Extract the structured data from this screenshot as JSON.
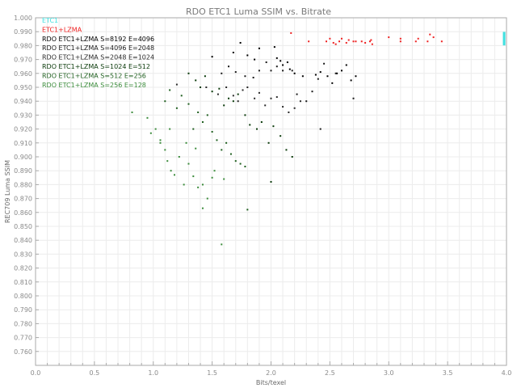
{
  "chart_data": {
    "type": "scatter",
    "title": "RDO ETC1 Luma SSIM vs. Bitrate",
    "xlabel": "Bits/texel",
    "ylabel": "REC709 Luma SSIM",
    "xlim": [
      0.0,
      4.0
    ],
    "ylim": [
      0.75,
      1.0
    ],
    "x_ticks": [
      "0.0",
      "0.5",
      "1.0",
      "1.5",
      "2.0",
      "2.5",
      "3.0",
      "3.5",
      "4.0"
    ],
    "y_ticks": [
      "0.760",
      "0.770",
      "0.780",
      "0.790",
      "0.800",
      "0.810",
      "0.820",
      "0.830",
      "0.840",
      "0.850",
      "0.860",
      "0.870",
      "0.880",
      "0.890",
      "0.900",
      "0.910",
      "0.920",
      "0.930",
      "0.940",
      "0.950",
      "0.960",
      "0.970",
      "0.980",
      "0.990",
      "1.000"
    ],
    "x_tick_values": [
      0.0,
      0.5,
      1.0,
      1.5,
      2.0,
      2.5,
      3.0,
      3.5,
      4.0
    ],
    "y_tick_values": [
      0.76,
      0.77,
      0.78,
      0.79,
      0.8,
      0.81,
      0.82,
      0.83,
      0.84,
      0.85,
      0.86,
      0.87,
      0.88,
      0.89,
      0.9,
      0.91,
      0.92,
      0.93,
      0.94,
      0.95,
      0.96,
      0.97,
      0.98,
      0.99,
      1.0
    ],
    "grid": true,
    "legend_position": "top-left",
    "series": [
      {
        "name": "ETC1",
        "color": "#40e0e0",
        "points": [
          [
            3.98,
            0.981
          ],
          [
            3.98,
            0.982
          ],
          [
            3.98,
            0.983
          ],
          [
            3.98,
            0.984
          ],
          [
            3.98,
            0.985
          ],
          [
            3.98,
            0.986
          ],
          [
            3.98,
            0.987
          ],
          [
            3.98,
            0.988
          ],
          [
            3.98,
            0.989
          ]
        ]
      },
      {
        "name": "ETC1+LZMA",
        "color": "#ee2222",
        "points": [
          [
            2.17,
            0.989
          ],
          [
            2.32,
            0.983
          ],
          [
            2.47,
            0.983
          ],
          [
            2.5,
            0.985
          ],
          [
            2.53,
            0.982
          ],
          [
            2.55,
            0.981
          ],
          [
            2.58,
            0.983
          ],
          [
            2.6,
            0.985
          ],
          [
            2.64,
            0.982
          ],
          [
            2.66,
            0.984
          ],
          [
            2.7,
            0.983
          ],
          [
            2.72,
            0.983
          ],
          [
            2.77,
            0.983
          ],
          [
            2.8,
            0.982
          ],
          [
            2.84,
            0.983
          ],
          [
            2.85,
            0.984
          ],
          [
            2.86,
            0.981
          ],
          [
            3.0,
            0.986
          ],
          [
            3.1,
            0.983
          ],
          [
            3.1,
            0.985
          ],
          [
            3.23,
            0.983
          ],
          [
            3.25,
            0.985
          ],
          [
            3.33,
            0.983
          ],
          [
            3.35,
            0.988
          ],
          [
            3.38,
            0.986
          ],
          [
            3.45,
            0.983
          ]
        ]
      },
      {
        "name": "RDO ETC1+LZMA S=8192 E=4096",
        "color": "#000000",
        "points": [
          [
            1.5,
            0.972
          ],
          [
            1.68,
            0.975
          ],
          [
            1.74,
            0.982
          ],
          [
            1.8,
            0.973
          ],
          [
            1.86,
            0.97
          ],
          [
            1.9,
            0.978
          ],
          [
            2.03,
            0.979
          ],
          [
            2.05,
            0.971
          ],
          [
            2.08,
            0.969
          ],
          [
            2.1,
            0.966
          ],
          [
            2.14,
            0.968
          ],
          [
            2.16,
            0.963
          ],
          [
            2.2,
            0.96
          ],
          [
            2.27,
            0.958
          ],
          [
            2.38,
            0.959
          ],
          [
            2.42,
            0.961
          ],
          [
            2.48,
            0.958
          ],
          [
            2.52,
            0.953
          ],
          [
            2.56,
            0.96
          ],
          [
            2.6,
            0.962
          ],
          [
            2.64,
            0.966
          ],
          [
            2.68,
            0.955
          ],
          [
            2.72,
            0.958
          ]
        ]
      },
      {
        "name": "RDO ETC1+LZMA S=4096 E=2048",
        "color": "#1a1a1a",
        "points": [
          [
            1.58,
            0.96
          ],
          [
            1.64,
            0.965
          ],
          [
            1.7,
            0.961
          ],
          [
            1.78,
            0.958
          ],
          [
            1.85,
            0.957
          ],
          [
            1.9,
            0.962
          ],
          [
            1.96,
            0.968
          ],
          [
            2.0,
            0.962
          ],
          [
            2.05,
            0.965
          ],
          [
            2.1,
            0.962
          ],
          [
            2.18,
            0.962
          ],
          [
            2.22,
            0.945
          ],
          [
            2.3,
            0.94
          ],
          [
            2.35,
            0.947
          ],
          [
            2.4,
            0.956
          ],
          [
            2.45,
            0.967
          ],
          [
            2.55,
            0.96
          ],
          [
            2.7,
            0.942
          ],
          [
            2.42,
            0.92
          ]
        ]
      },
      {
        "name": "RDO ETC1+LZMA S=2048 E=1024",
        "color": "#2a2a2a",
        "points": [
          [
            1.2,
            0.952
          ],
          [
            1.45,
            0.95
          ],
          [
            1.55,
            0.945
          ],
          [
            1.62,
            0.95
          ],
          [
            1.68,
            0.944
          ],
          [
            1.72,
            0.94
          ],
          [
            1.76,
            0.948
          ],
          [
            1.8,
            0.95
          ],
          [
            1.86,
            0.942
          ],
          [
            1.9,
            0.946
          ],
          [
            1.95,
            0.937
          ],
          [
            2.0,
            0.942
          ],
          [
            2.05,
            0.943
          ],
          [
            2.1,
            0.936
          ],
          [
            2.15,
            0.932
          ],
          [
            2.2,
            0.935
          ],
          [
            2.25,
            0.94
          ]
        ]
      },
      {
        "name": "RDO ETC1+LZMA S=1024 E=512",
        "color": "#0a3a0a",
        "points": [
          [
            1.3,
            0.96
          ],
          [
            1.36,
            0.955
          ],
          [
            1.4,
            0.95
          ],
          [
            1.44,
            0.958
          ],
          [
            1.5,
            0.947
          ],
          [
            1.56,
            0.949
          ],
          [
            1.6,
            0.937
          ],
          [
            1.64,
            0.942
          ],
          [
            1.68,
            0.94
          ],
          [
            1.72,
            0.945
          ],
          [
            1.78,
            0.93
          ],
          [
            1.82,
            0.923
          ],
          [
            1.88,
            0.92
          ],
          [
            1.92,
            0.925
          ],
          [
            1.98,
            0.91
          ],
          [
            2.02,
            0.922
          ],
          [
            2.08,
            0.915
          ],
          [
            2.13,
            0.905
          ],
          [
            2.18,
            0.9
          ],
          [
            2.0,
            0.882
          ]
        ]
      },
      {
        "name": "RDO ETC1+LZMA S=512 E=256",
        "color": "#1f5f1f",
        "points": [
          [
            1.1,
            0.94
          ],
          [
            1.14,
            0.948
          ],
          [
            1.2,
            0.935
          ],
          [
            1.24,
            0.944
          ],
          [
            1.3,
            0.938
          ],
          [
            1.34,
            0.92
          ],
          [
            1.38,
            0.932
          ],
          [
            1.42,
            0.925
          ],
          [
            1.46,
            0.93
          ],
          [
            1.5,
            0.918
          ],
          [
            1.54,
            0.912
          ],
          [
            1.58,
            0.905
          ],
          [
            1.62,
            0.91
          ],
          [
            1.66,
            0.902
          ],
          [
            1.7,
            0.897
          ],
          [
            1.74,
            0.895
          ],
          [
            1.78,
            0.893
          ],
          [
            1.8,
            0.862
          ]
        ]
      },
      {
        "name": "RDO ETC1+LZMA S=256 E=128",
        "color": "#3c8c3c",
        "points": [
          [
            0.82,
            0.932
          ],
          [
            0.95,
            0.928
          ],
          [
            0.98,
            0.917
          ],
          [
            1.02,
            0.92
          ],
          [
            1.06,
            0.91
          ],
          [
            1.1,
            0.905
          ],
          [
            1.12,
            0.897
          ],
          [
            1.15,
            0.89
          ],
          [
            1.18,
            0.887
          ],
          [
            1.22,
            0.9
          ],
          [
            1.26,
            0.88
          ],
          [
            1.3,
            0.895
          ],
          [
            1.34,
            0.886
          ],
          [
            1.38,
            0.878
          ],
          [
            1.42,
            0.88
          ],
          [
            1.46,
            0.87
          ],
          [
            1.5,
            0.885
          ],
          [
            1.52,
            0.89
          ],
          [
            1.6,
            0.884
          ],
          [
            1.42,
            0.863
          ],
          [
            1.58,
            0.837
          ],
          [
            1.06,
            0.912
          ],
          [
            1.14,
            0.92
          ],
          [
            1.28,
            0.91
          ],
          [
            1.36,
            0.906
          ]
        ]
      }
    ]
  }
}
